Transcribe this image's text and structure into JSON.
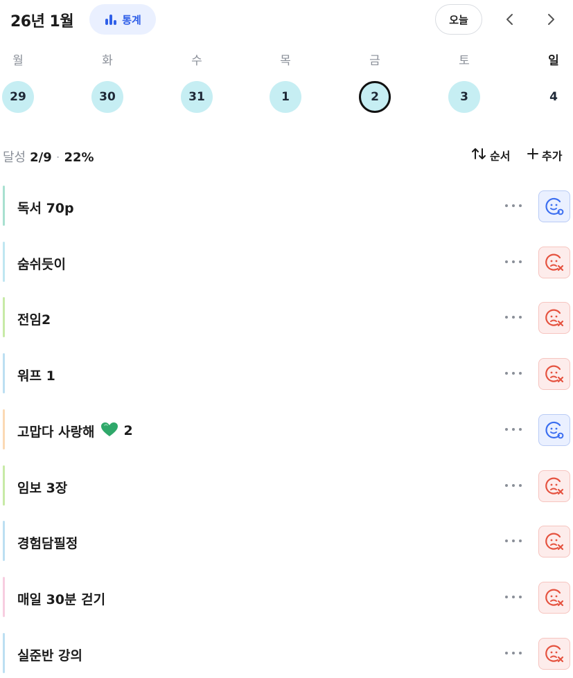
{
  "header": {
    "month_title": "26년 1월",
    "stats_label": "통계",
    "today_label": "오늘"
  },
  "week": {
    "days": [
      {
        "name": "월",
        "date": "29",
        "state": "done"
      },
      {
        "name": "화",
        "date": "30",
        "state": "done"
      },
      {
        "name": "수",
        "date": "31",
        "state": "done"
      },
      {
        "name": "목",
        "date": "1",
        "state": "done"
      },
      {
        "name": "금",
        "date": "2",
        "state": "selected"
      },
      {
        "name": "토",
        "date": "3",
        "state": "done"
      },
      {
        "name": "일",
        "date": "4",
        "state": "plain"
      }
    ]
  },
  "summary": {
    "achieve_label": "달성",
    "ratio": "2/9",
    "separator": "·",
    "percent": "22%",
    "sort_label": "순서",
    "add_label": "추가"
  },
  "items": [
    {
      "label": "독서 70p",
      "bar_color": "#a8e0d0",
      "status": "ok"
    },
    {
      "label": "숨쉬듯이",
      "bar_color": "#bfe6f1",
      "status": "fail"
    },
    {
      "label": "전임2",
      "bar_color": "#c7eaa6",
      "status": "fail"
    },
    {
      "label": "워프 1",
      "bar_color": "#bcdff2",
      "status": "fail"
    },
    {
      "label": "고맙다 사랑해",
      "suffix": "2",
      "heart": "green-heart-icon",
      "bar_color": "#fbd9b4",
      "status": "ok"
    },
    {
      "label": "임보 3장",
      "bar_color": "#c7eaa6",
      "status": "fail"
    },
    {
      "label": "경험담필정",
      "bar_color": "#bcdff2",
      "status": "fail"
    },
    {
      "label": "매일 30분 걷기",
      "bar_color": "#f7cde0",
      "status": "fail"
    },
    {
      "label": "실준반 강의",
      "bar_color": "#bcdff2",
      "status": "fail"
    }
  ],
  "colors": {
    "accent_blue": "#2f5fe8",
    "ok_icon": "#3b6ef0",
    "fail_icon": "#e5523f",
    "done_circle": "#c6eef3"
  },
  "icons": {
    "stats": "bar-chart-icon",
    "prev": "chevron-left-icon",
    "next": "chevron-right-icon",
    "sort": "sort-arrows-icon",
    "add": "plus-icon",
    "more": "more-horizontal-icon",
    "ok": "smile-check-icon",
    "fail": "frown-x-icon"
  }
}
